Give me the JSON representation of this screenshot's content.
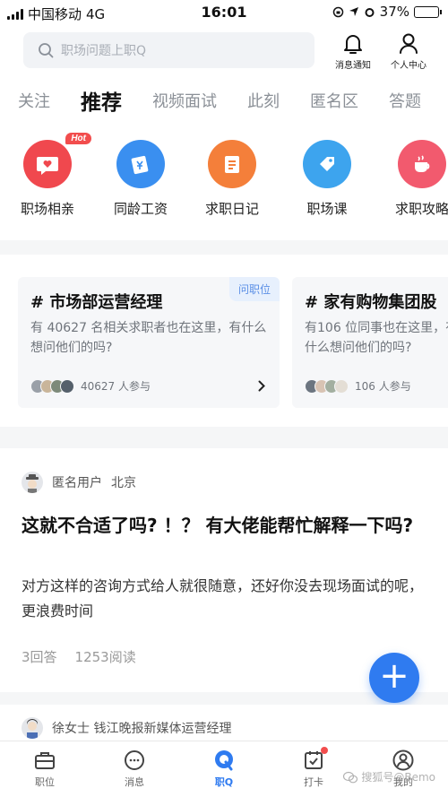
{
  "status_bar": {
    "carrier": "中国移动",
    "network": "4G",
    "time": "16:01",
    "battery_percent": "37%",
    "battery_level": 0.37
  },
  "header": {
    "search_placeholder": "职场问题上职Q",
    "notify_label": "消息通知",
    "profile_label": "个人中心"
  },
  "tabs": [
    "关注",
    "推荐",
    "视频面试",
    "此刻",
    "匿名区",
    "答题"
  ],
  "active_tab": 1,
  "categories": [
    {
      "label": "职场相亲",
      "color": "#f0484e",
      "icon": "heart-chat-icon",
      "badge": "Hot"
    },
    {
      "label": "同龄工资",
      "color": "#3a8ff0",
      "icon": "money-card-icon"
    },
    {
      "label": "求职日记",
      "color": "#f47f3a",
      "icon": "notebook-icon"
    },
    {
      "label": "职场课",
      "color": "#3da4ee",
      "icon": "tag-icon"
    },
    {
      "label": "求职攻略",
      "color": "#f25a6e",
      "icon": "cup-icon"
    }
  ],
  "topics": [
    {
      "title": "# 市场部运营经理",
      "badge": "问职位",
      "desc": "有 40627 名相关求职者也在这里，有什么想问他们的吗?",
      "participants": "40627 人参与"
    },
    {
      "title": "# 家有购物集团股",
      "desc": "有106 位同事也在这里，有什么想问他们的吗?",
      "participants": "106 人参与"
    }
  ],
  "post": {
    "user": "匿名用户",
    "city": "北京",
    "title": "这就不合适了吗? ！？ 有大佬能帮忙解释一下吗?",
    "body": "对方这样的咨询方式给人就很随意，还好你没去现场面试的呢，更浪费时间",
    "answers": "3回答",
    "reads": "1253阅读"
  },
  "post2": {
    "user": "徐女士 钱江晚报新媒体运营经理"
  },
  "fab": {
    "label": "+"
  },
  "bottom_nav": [
    {
      "label": "职位",
      "icon": "briefcase-icon"
    },
    {
      "label": "消息",
      "icon": "chat-icon"
    },
    {
      "label": "职Q",
      "icon": "q-icon"
    },
    {
      "label": "打卡",
      "icon": "checkin-icon"
    },
    {
      "label": "我的",
      "icon": "user-icon"
    }
  ],
  "active_nav": 2,
  "watermark": "搜狐号@Bemo",
  "colors": {
    "accent": "#2f7bf0",
    "hot_red": "#f24d4d"
  }
}
